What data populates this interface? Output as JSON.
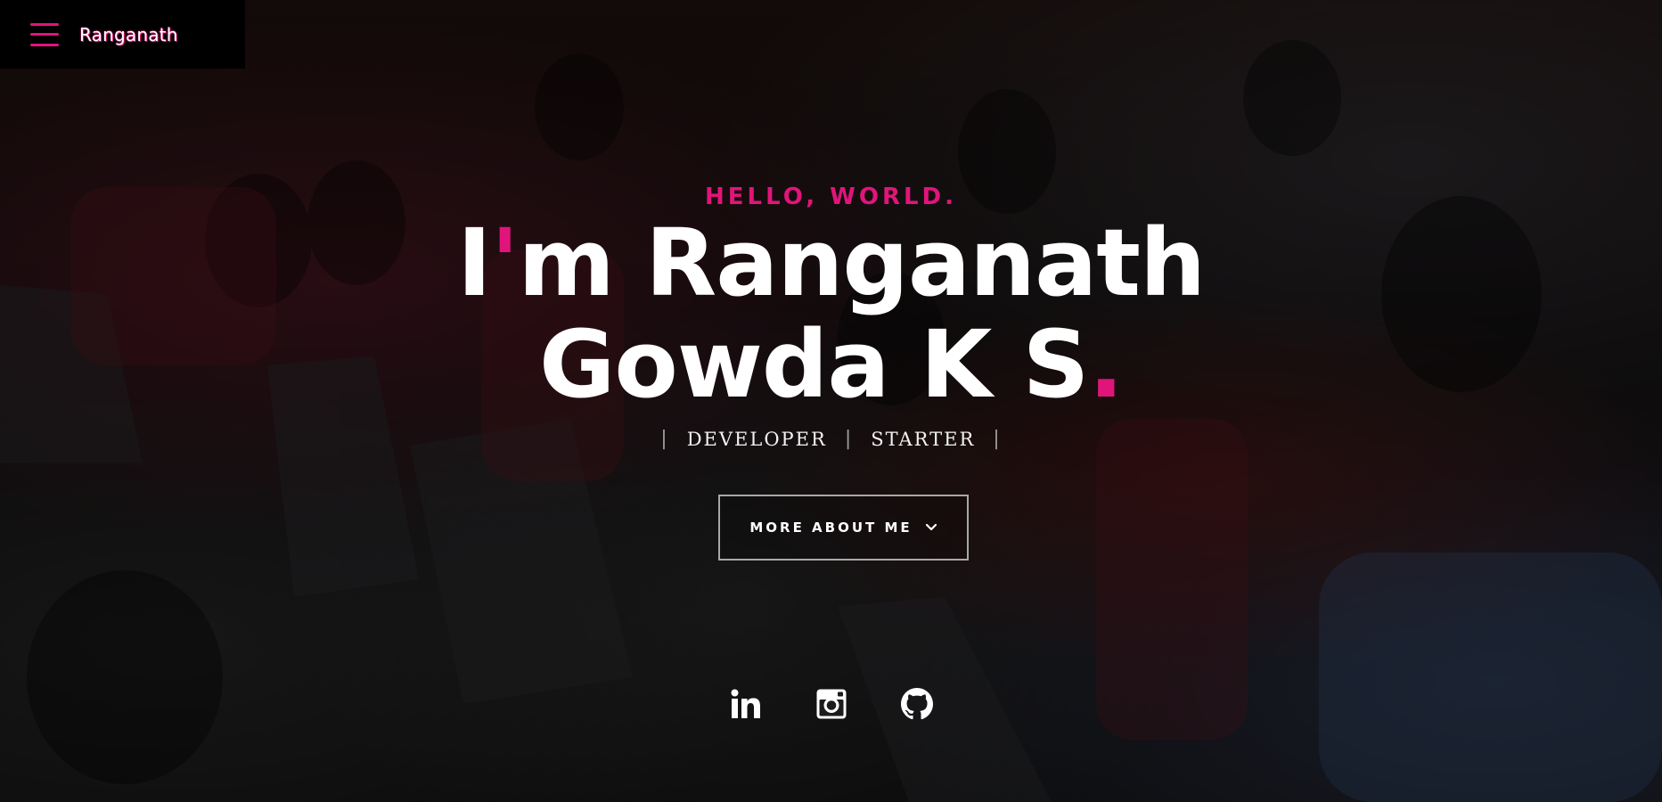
{
  "header": {
    "menu_icon": "hamburger-menu-icon",
    "brand_name": "Ranganath"
  },
  "hero": {
    "greeting": "HELLO, WORLD.",
    "headline": {
      "line1_prefix": "I",
      "line1_apostrophe": "'",
      "line1_rest": "m Ranganath",
      "line2": "Gowda K S",
      "line2_dot": "."
    },
    "roles": [
      "DEVELOPER",
      "STARTER"
    ],
    "role_separator": "|",
    "more_button": {
      "label": "MORE ABOUT ME",
      "icon": "chevron-down-icon"
    }
  },
  "socials": [
    {
      "name": "LinkedIn",
      "icon": "linkedin-icon"
    },
    {
      "name": "Instagram",
      "icon": "instagram-icon"
    },
    {
      "name": "GitHub",
      "icon": "github-icon"
    }
  ],
  "colors": {
    "accent": "#e0157a",
    "header_bg": "#000000",
    "text": "#ffffff",
    "button_border": "#a8a8a8"
  }
}
